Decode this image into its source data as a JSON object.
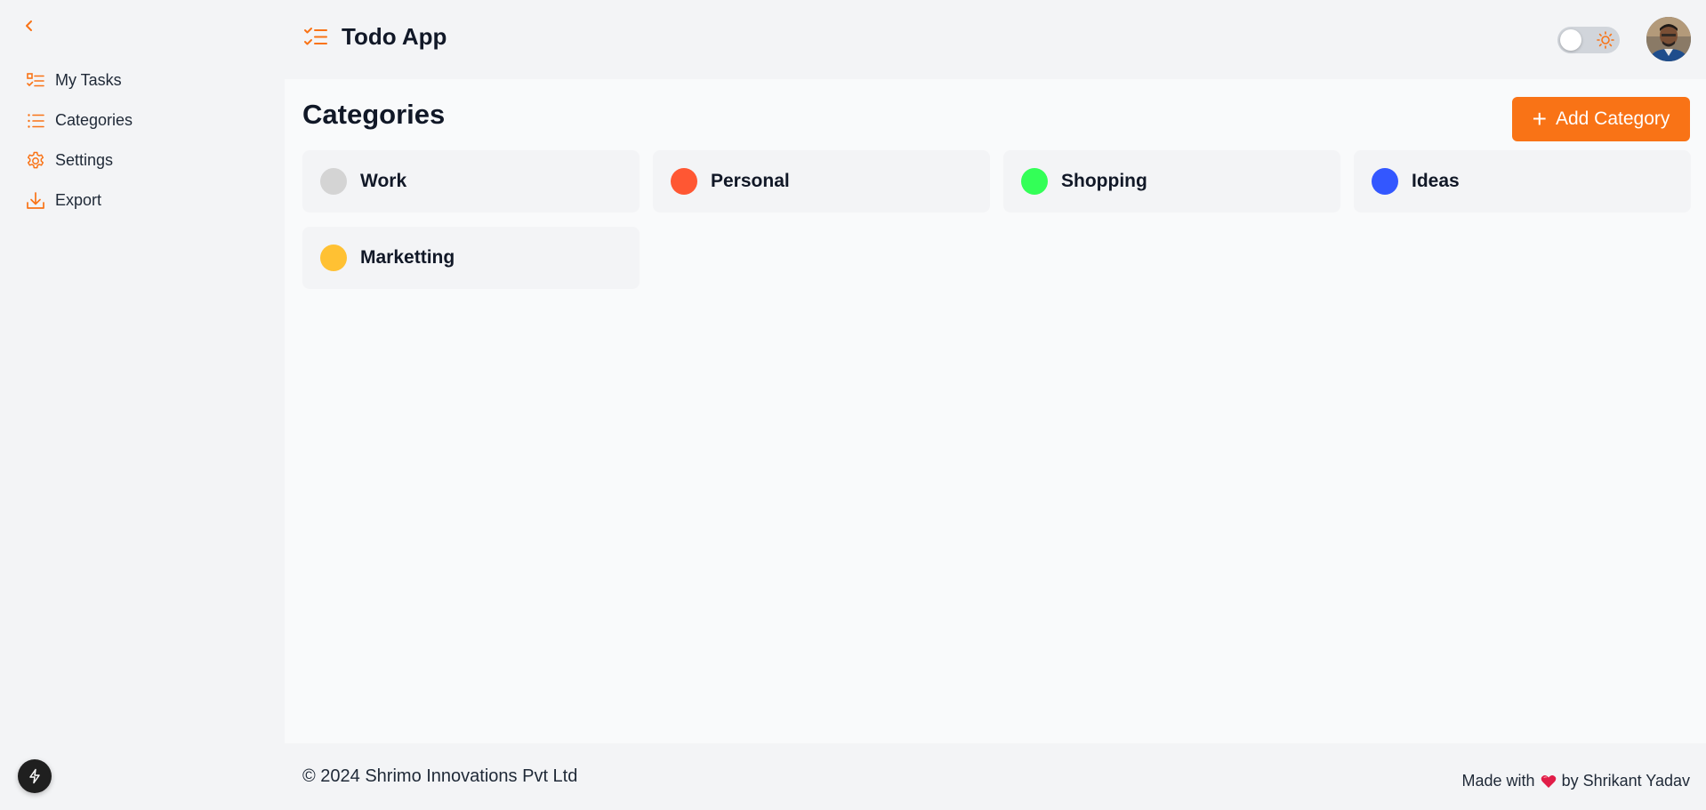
{
  "sidebar": {
    "collapse_icon": "chevron-left-icon",
    "items": [
      {
        "label": "My Tasks",
        "icon": "task-list-icon"
      },
      {
        "label": "Categories",
        "icon": "list-icon"
      },
      {
        "label": "Settings",
        "icon": "gear-icon"
      },
      {
        "label": "Export",
        "icon": "download-icon"
      }
    ],
    "bolt_icon": "bolt-icon"
  },
  "header": {
    "title": "Todo App",
    "theme": "light"
  },
  "main": {
    "title": "Categories",
    "add_button_label": "Add Category",
    "categories": [
      {
        "name": "Work",
        "color": "#d4d4d4"
      },
      {
        "name": "Personal",
        "color": "#ff5733"
      },
      {
        "name": "Shopping",
        "color": "#33ff57"
      },
      {
        "name": "Ideas",
        "color": "#3357ff"
      },
      {
        "name": "Marketting",
        "color": "#ffc133"
      }
    ]
  },
  "footer": {
    "copyright": "© 2024 Shrimo Innovations Pvt Ltd",
    "made_with": "Made with",
    "by": "by Shrikant Yadav"
  },
  "colors": {
    "accent": "#f97316"
  }
}
